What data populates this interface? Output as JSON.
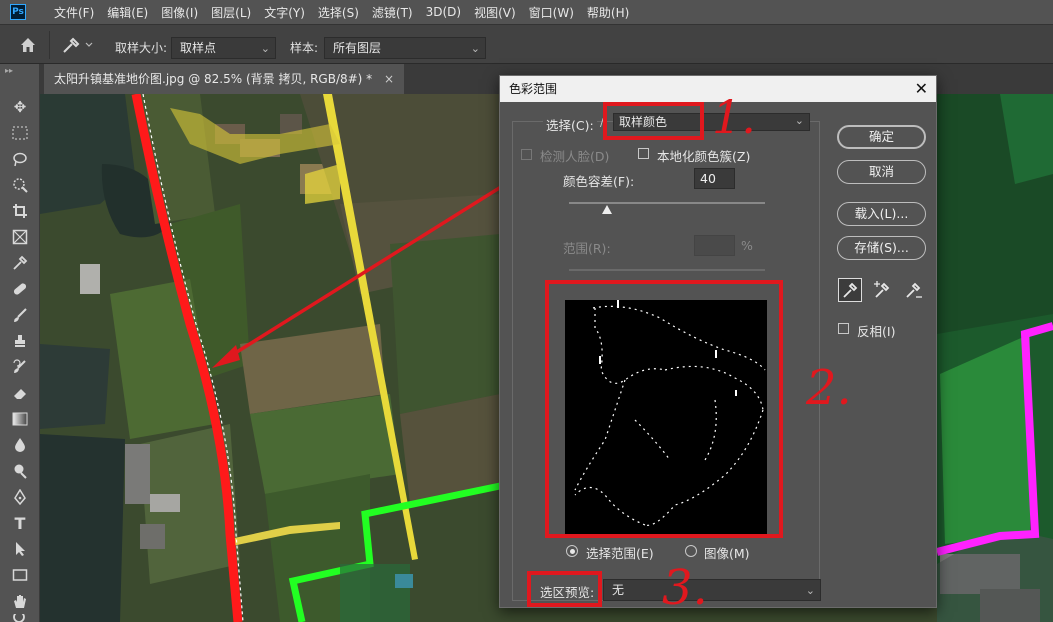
{
  "menubar": {
    "logo": "Ps",
    "items": [
      "文件(F)",
      "编辑(E)",
      "图像(I)",
      "图层(L)",
      "文字(Y)",
      "选择(S)",
      "滤镜(T)",
      "3D(D)",
      "视图(V)",
      "窗口(W)",
      "帮助(H)"
    ]
  },
  "options": {
    "sample_size_label": "取样大小:",
    "sample_size_value": "取样点",
    "sample_label": "样本:",
    "sample_value": "所有图层"
  },
  "document_tab": {
    "title": "太阳升镇基准地价图.jpg @ 82.5% (背景 拷贝, RGB/8#) *",
    "close": "×"
  },
  "dialog": {
    "title": "色彩范围",
    "close": "✕",
    "select_label": "选择(C):",
    "select_value": "取样颜色",
    "detect_faces_label": "检测人脸(D)",
    "localized_label": "本地化颜色簇(Z)",
    "fuzziness_label": "颜色容差(F):",
    "fuzziness_value": "40",
    "range_label": "范围(R):",
    "range_value": "",
    "range_unit": "%",
    "radio_selection_label": "选择范围(E)",
    "radio_image_label": "图像(M)",
    "radio_selected": "selection",
    "preview_label": "选区预览:",
    "preview_value": "无",
    "ok_label": "确定",
    "cancel_label": "取消",
    "load_label": "载入(L)...",
    "save_label": "存储(S)...",
    "invert_label": "反相(I)"
  },
  "annotations": {
    "one": "1.",
    "two": "2.",
    "three": "3."
  },
  "colors": {
    "annotation_red": "#e0181e",
    "boundary_red": "#ff1a1a",
    "road_yellow": "#e8d93a",
    "boundary_green": "#22ff22",
    "boundary_magenta": "#ff22ff"
  }
}
